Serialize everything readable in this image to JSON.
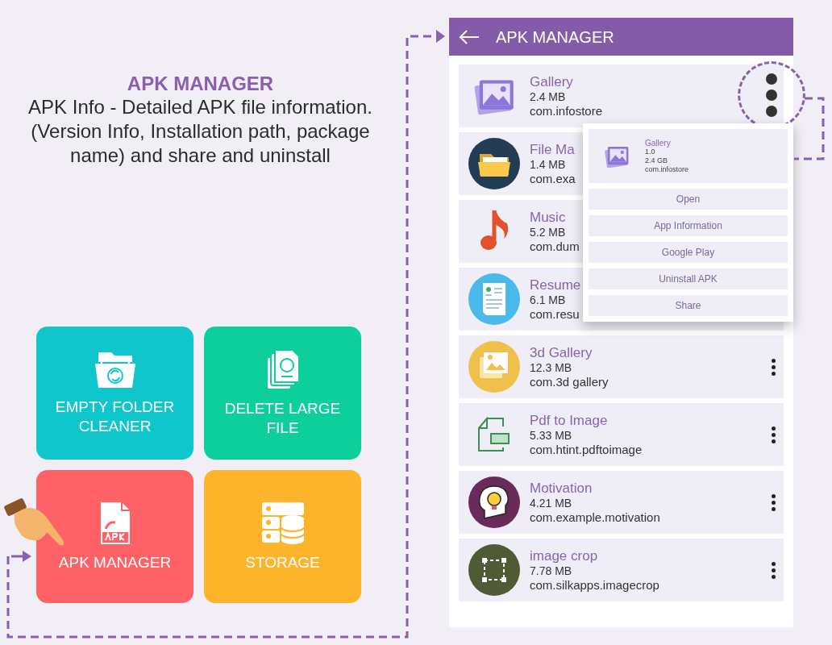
{
  "promo": {
    "title": "APK MANAGER",
    "description": "APK Info - Detailed APK file information. (Version Info, Installation path, package name) and share and uninstall"
  },
  "tiles": [
    {
      "label": "EMPTY FOLDER CLEANER",
      "color": "#10c6cd",
      "kind": "folder"
    },
    {
      "label": "DELETE LARGE FILE",
      "color": "#0ccf9b",
      "kind": "files"
    },
    {
      "label": "APK MANAGER",
      "color": "#fe6266",
      "kind": "apk"
    },
    {
      "label": "STORAGE",
      "color": "#fdb42b",
      "kind": "storage"
    }
  ],
  "screen": {
    "title": "APK MANAGER",
    "apps": [
      {
        "name": "Gallery",
        "size": "2.4 MB",
        "package": "com.infostore",
        "kind": "gallery",
        "menu_open": true
      },
      {
        "name": "File Ma",
        "size": "1.4 MB",
        "package": "com.exa",
        "kind": "folder",
        "menu_open": false
      },
      {
        "name": "Music",
        "size": "5.2 MB",
        "package": "com.dum",
        "kind": "music",
        "menu_open": false
      },
      {
        "name": "Resume",
        "size": "6.1 MB",
        "package": "com.resu",
        "kind": "resume",
        "menu_open": false
      },
      {
        "name": "3d Gallery",
        "size": "12.3 MB",
        "package": "com.3d gallery",
        "kind": "photos",
        "menu_open": false
      },
      {
        "name": "Pdf to Image",
        "size": "5.33 MB",
        "package": "com.htint.pdftoimage",
        "kind": "pdf",
        "menu_open": false
      },
      {
        "name": "Motivation",
        "size": "4.21 MB",
        "package": "com.example.motivation",
        "kind": "idea",
        "menu_open": false
      },
      {
        "name": "image crop",
        "size": "7.78 MB",
        "package": "com.silkapps.imagecrop",
        "kind": "crop",
        "menu_open": false
      }
    ],
    "popup": {
      "name": "Gallery",
      "version": "1.0",
      "size": "2.4 GB",
      "package": "com.infostore",
      "actions": [
        "Open",
        "App Information",
        "Google Play",
        "Uninstall APK",
        "Share"
      ]
    }
  }
}
